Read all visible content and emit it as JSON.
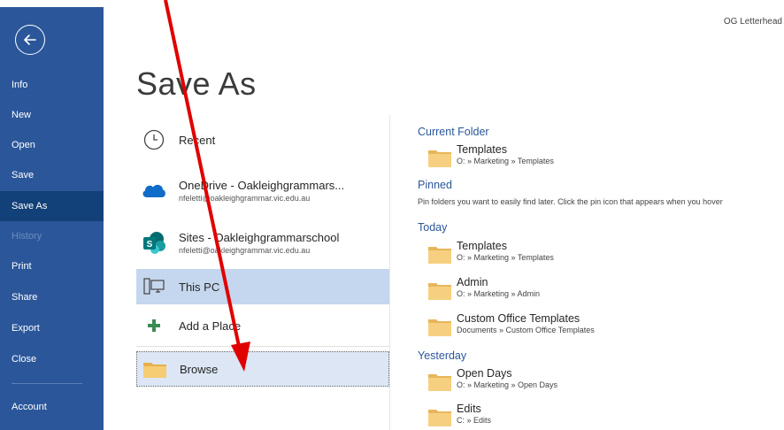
{
  "window": {
    "doc_title": "OG Letterhead"
  },
  "page": {
    "title": "Save As"
  },
  "sidebar": {
    "items": [
      {
        "label": "Info"
      },
      {
        "label": "New"
      },
      {
        "label": "Open"
      },
      {
        "label": "Save"
      },
      {
        "label": "Save As",
        "active": true
      },
      {
        "label": "History",
        "disabled": true
      },
      {
        "label": "Print"
      },
      {
        "label": "Share"
      },
      {
        "label": "Export"
      },
      {
        "label": "Close"
      },
      {
        "label": "Account"
      }
    ]
  },
  "locations": [
    {
      "name": "Recent",
      "icon": "clock-icon"
    },
    {
      "name": "OneDrive - Oakleighgrammars...",
      "sub": "nfeletti@oakleighgrammar.vic.edu.au",
      "icon": "onedrive-icon"
    },
    {
      "name": "Sites - Oakleighgrammarschool",
      "sub": "nfeletti@oakleighgrammar.vic.edu.au",
      "icon": "sharepoint-icon"
    },
    {
      "name": "This PC",
      "icon": "computer-icon",
      "selected": true
    },
    {
      "name": "Add a Place",
      "icon": "plus-icon"
    },
    {
      "name": "Browse",
      "icon": "folder-icon"
    }
  ],
  "folders": {
    "current_folder": {
      "heading": "Current Folder",
      "items": [
        {
          "name": "Templates",
          "path": "O: » Marketing » Templates"
        }
      ]
    },
    "pinned": {
      "heading": "Pinned",
      "hint": "Pin folders you want to easily find later. Click the pin icon that appears when you hover"
    },
    "today": {
      "heading": "Today",
      "items": [
        {
          "name": "Templates",
          "path": "O: » Marketing » Templates"
        },
        {
          "name": "Admin",
          "path": "O: » Marketing » Admin"
        },
        {
          "name": "Custom Office Templates",
          "path": "Documents » Custom Office Templates"
        }
      ]
    },
    "yesterday": {
      "heading": "Yesterday",
      "items": [
        {
          "name": "Open Days",
          "path": "O: » Marketing » Open Days"
        },
        {
          "name": "Edits",
          "path": "C: » Edits"
        }
      ]
    }
  },
  "colors": {
    "sidebar": "#2b579a",
    "sidebar_active": "#124078",
    "accent": "#2b579a",
    "selected": "#c5d7ee",
    "folder": "#f3c76b",
    "annotation_arrow": "#e00000"
  }
}
